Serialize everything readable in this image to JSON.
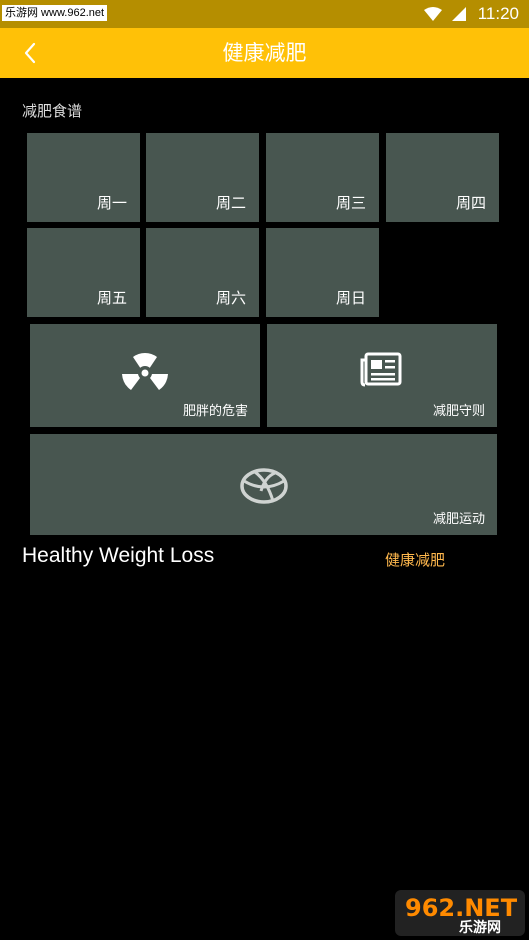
{
  "status_bar": {
    "watermark": "乐游网 www.962.net",
    "time": "11:20"
  },
  "app_bar": {
    "title": "健康减肥",
    "back_icon": "chevron-left-icon"
  },
  "section": {
    "label": "减肥食谱"
  },
  "days": [
    {
      "label": "周一"
    },
    {
      "label": "周二"
    },
    {
      "label": "周三"
    },
    {
      "label": "周四"
    },
    {
      "label": "周五"
    },
    {
      "label": "周六"
    },
    {
      "label": "周日"
    }
  ],
  "feature_tiles": [
    {
      "label": "肥胖的危害",
      "icon": "radiation-icon"
    },
    {
      "label": "减肥守则",
      "icon": "newspaper-icon"
    },
    {
      "label": "减肥运动",
      "icon": "basketball-icon"
    }
  ],
  "footer": {
    "title": "Healthy Weight Loss",
    "category": "健康减肥"
  },
  "logo": {
    "text_top": "962.NET",
    "text_bottom": "乐游网"
  },
  "colors": {
    "app_bar": "#ffc107",
    "tile": "#485650",
    "accent_text": "#ffb84d"
  }
}
